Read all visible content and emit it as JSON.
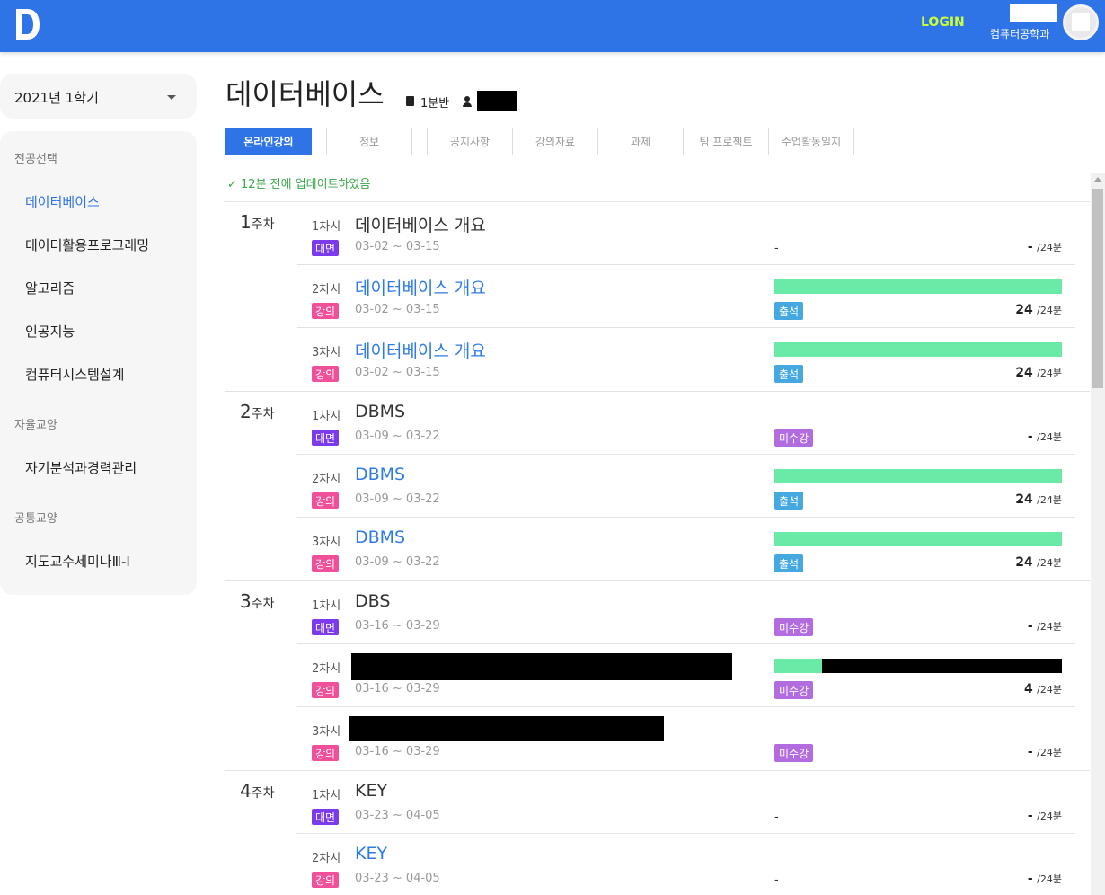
{
  "header": {
    "login": "LOGIN",
    "department": "컴퓨터공학과",
    "accent": "#2f74e6"
  },
  "sidebar": {
    "semester": "2021년 1학기",
    "groups": [
      {
        "heading": "전공선택",
        "items": [
          "데이터베이스",
          "데이터활용프로그래밍",
          "알고리즘",
          "인공지능",
          "컴퓨터시스템설계"
        ]
      },
      {
        "heading": "자율교양",
        "items": [
          "자기분석과경력관리"
        ]
      },
      {
        "heading": "공통교양",
        "items": [
          "지도교수세미나Ⅲ-Ⅰ"
        ]
      }
    ]
  },
  "course": {
    "title": "데이터베이스",
    "section": "1분반"
  },
  "tabs": [
    "온라인강의",
    "정보",
    "공지사항",
    "강의자료",
    "과제",
    "팀 프로젝트",
    "수업활동일지"
  ],
  "updated": "✓ 12분 전에 업데이트하였음",
  "week_suffix": "주차",
  "session_suffix": "차시",
  "total": "/24분",
  "weeks": [
    {
      "num": "1",
      "lectures": [
        {
          "sess": "1",
          "title": "데이터베이스 개요",
          "type": "대면",
          "dates": "03-02 ~ 03-15",
          "progress": null,
          "status": "-",
          "watched": "-"
        },
        {
          "sess": "2",
          "title": "데이터베이스 개요",
          "type": "강의",
          "dates": "03-02 ~ 03-15",
          "progress": 1.0,
          "status": "출석",
          "watched": "24"
        },
        {
          "sess": "3",
          "title": "데이터베이스 개요",
          "type": "강의",
          "dates": "03-02 ~ 03-15",
          "progress": 1.0,
          "status": "출석",
          "watched": "24"
        }
      ]
    },
    {
      "num": "2",
      "lectures": [
        {
          "sess": "1",
          "title": "DBMS",
          "type": "대면",
          "dates": "03-09 ~ 03-22",
          "progress": null,
          "status": "미수강",
          "watched": "-"
        },
        {
          "sess": "2",
          "title": "DBMS",
          "type": "강의",
          "dates": "03-09 ~ 03-22",
          "progress": 1.0,
          "status": "출석",
          "watched": "24"
        },
        {
          "sess": "3",
          "title": "DBMS",
          "type": "강의",
          "dates": "03-09 ~ 03-22",
          "progress": 1.0,
          "status": "출석",
          "watched": "24"
        }
      ]
    },
    {
      "num": "3",
      "lectures": [
        {
          "sess": "1",
          "title": "DBS",
          "type": "대면",
          "dates": "03-16 ~ 03-29",
          "progress": null,
          "status": "미수강",
          "watched": "-"
        },
        {
          "sess": "2",
          "title": "",
          "redacted": true,
          "type": "강의",
          "dates": "03-16 ~ 03-29",
          "progress": 0.165,
          "status": "미수강",
          "watched": "4"
        },
        {
          "sess": "3",
          "title": "",
          "redacted": true,
          "type": "강의",
          "dates": "03-16 ~ 03-29",
          "progress": null,
          "status": "미수강",
          "watched": "-"
        }
      ]
    },
    {
      "num": "4",
      "lectures": [
        {
          "sess": "1",
          "title": "KEY",
          "type": "대면",
          "dates": "03-23 ~ 04-05",
          "progress": null,
          "status": "-",
          "watched": "-"
        },
        {
          "sess": "2",
          "title": "KEY",
          "type": "강의",
          "dates": "03-23 ~ 04-05",
          "progress": null,
          "status": "-",
          "watched": "-"
        }
      ]
    }
  ]
}
